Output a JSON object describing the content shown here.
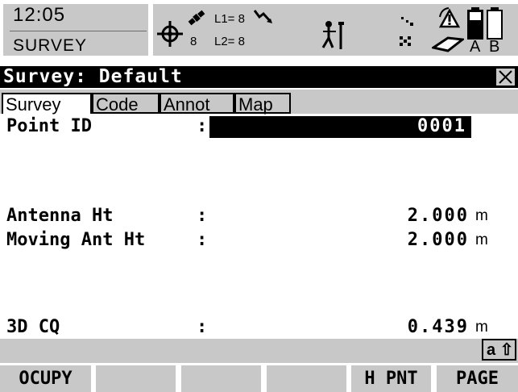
{
  "status_bar": {
    "time": "12:05",
    "mode": "SURVEY",
    "gps_icon": "gps-position-icon",
    "satellite_icon": "satellite-icon",
    "sats_tracked": "8",
    "l1_label": "L1= 8",
    "l2_label": "L2= 8",
    "link_icon": "radio-link-icon",
    "moving_icon": "moving-surveyor-icon",
    "warning_icon": "warning-icon",
    "battery_a_label": "A",
    "battery_b_label": "B"
  },
  "title_bar": {
    "title": "Survey: Default",
    "close_icon": "close-icon"
  },
  "tabs": [
    {
      "label": "Survey",
      "active": true
    },
    {
      "label": "Code",
      "active": false
    },
    {
      "label": "Annot",
      "active": false
    },
    {
      "label": "Map",
      "active": false
    }
  ],
  "fields": {
    "point_id": {
      "label": "Point ID",
      "colon": ":",
      "value": "0001"
    },
    "antenna_ht": {
      "label": "Antenna Ht",
      "colon": ":",
      "value": "2.000",
      "unit": "m"
    },
    "moving_ant_ht": {
      "label": "Moving Ant Ht",
      "colon": ":",
      "value": "2.000",
      "unit": "m"
    },
    "cq_3d": {
      "label": "3D CQ",
      "colon": ":",
      "value": "0.439",
      "unit": "m"
    }
  },
  "keyboard_indicator": "a ⇧",
  "function_keys": [
    "OCUPY",
    "",
    "",
    "",
    "H PNT",
    "PAGE"
  ]
}
